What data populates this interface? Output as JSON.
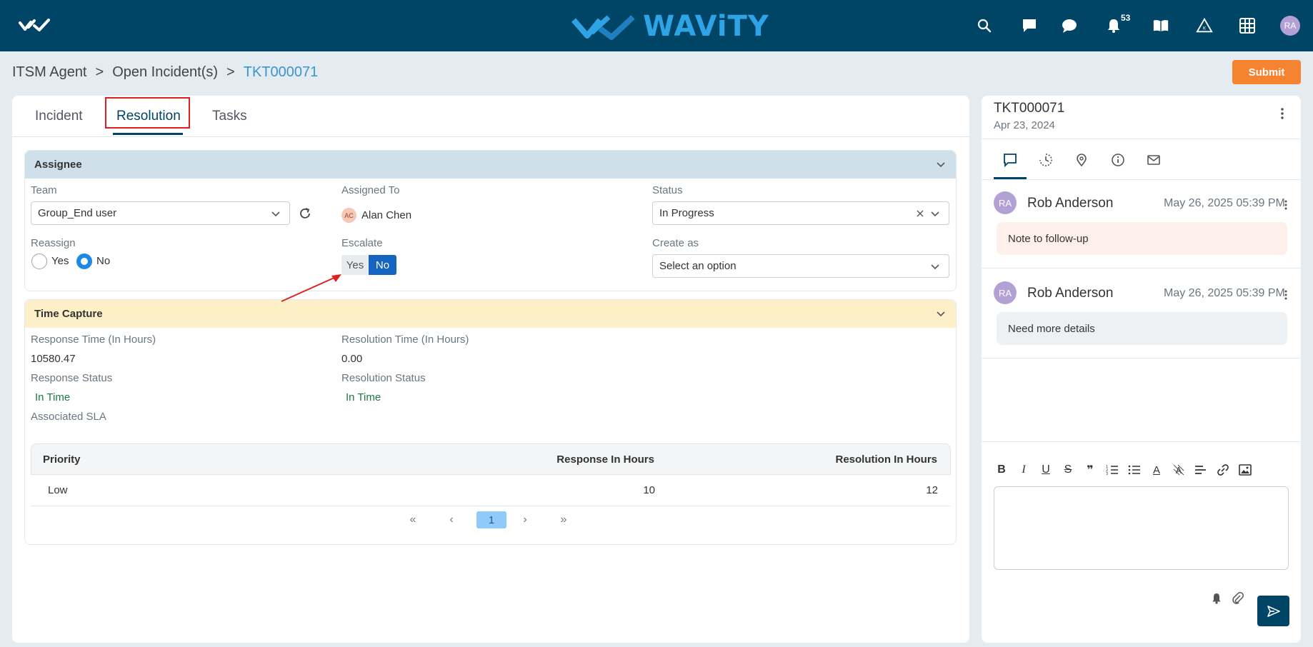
{
  "app": {
    "brand": "WAViTY",
    "notification_count": "53",
    "user_initials": "RA"
  },
  "breadcrumb": {
    "items": [
      "ITSM Agent",
      "Open Incident(s)"
    ],
    "current": "TKT000071",
    "separator": ">"
  },
  "actions": {
    "submit_label": "Submit"
  },
  "tabs": [
    {
      "label": "Incident",
      "active": false
    },
    {
      "label": "Resolution",
      "active": true
    },
    {
      "label": "Tasks",
      "active": false
    }
  ],
  "assignee": {
    "title": "Assignee",
    "team_label": "Team",
    "team_value": "Group_End user",
    "assigned_to_label": "Assigned To",
    "assigned_to_initials": "AC",
    "assigned_to_value": "Alan Chen",
    "status_label": "Status",
    "status_value": "In Progress",
    "reassign_label": "Reassign",
    "reassign_yes": "Yes",
    "reassign_no": "No",
    "reassign_selected": "No",
    "escalate_label": "Escalate",
    "escalate_yes": "Yes",
    "escalate_no": "No",
    "escalate_selected": "No",
    "create_as_label": "Create as",
    "create_as_placeholder": "Select an option"
  },
  "time_capture": {
    "title": "Time Capture",
    "response_time_label": "Response Time (In Hours)",
    "response_time_value": "10580.47",
    "resolution_time_label": "Resolution Time (In Hours)",
    "resolution_time_value": "0.00",
    "response_status_label": "Response Status",
    "response_status_value": "In Time",
    "resolution_status_label": "Resolution Status",
    "resolution_status_value": "In Time",
    "associated_sla_label": "Associated SLA",
    "sla_columns": [
      "Priority",
      "Response In Hours",
      "Resolution In Hours"
    ],
    "sla_rows": [
      {
        "priority": "Low",
        "response": "10",
        "resolution": "12"
      }
    ],
    "pagination": {
      "first": "«",
      "prev": "‹",
      "current": "1",
      "next": "›",
      "last": "»"
    }
  },
  "side": {
    "ticket_id": "TKT000071",
    "ticket_date": "Apr 23, 2024",
    "tabs": [
      "comment-icon",
      "history-icon",
      "location-icon",
      "info-icon",
      "mail-icon"
    ],
    "comments": [
      {
        "initials": "RA",
        "author": "Rob Anderson",
        "time": "May 26, 2025 05:39 PM",
        "text": "Note to follow-up",
        "bg": "#fdf0ea"
      },
      {
        "initials": "RA",
        "author": "Rob Anderson",
        "time": "May 26, 2025 05:39 PM",
        "text": "Need more details",
        "bg": "#eef1f4"
      }
    ],
    "toolbar": {
      "bold": "B",
      "italic": "I",
      "underline": "U",
      "strike": "S",
      "quote": "❞",
      "font_color": "A"
    }
  },
  "colors": {
    "topbar": "#004466",
    "accent": "#1565c0",
    "submit": "#f58330",
    "assignee_header": "#cfe0ea",
    "time_capture_header": "#fdf0c8",
    "highlight": "#e02020"
  }
}
